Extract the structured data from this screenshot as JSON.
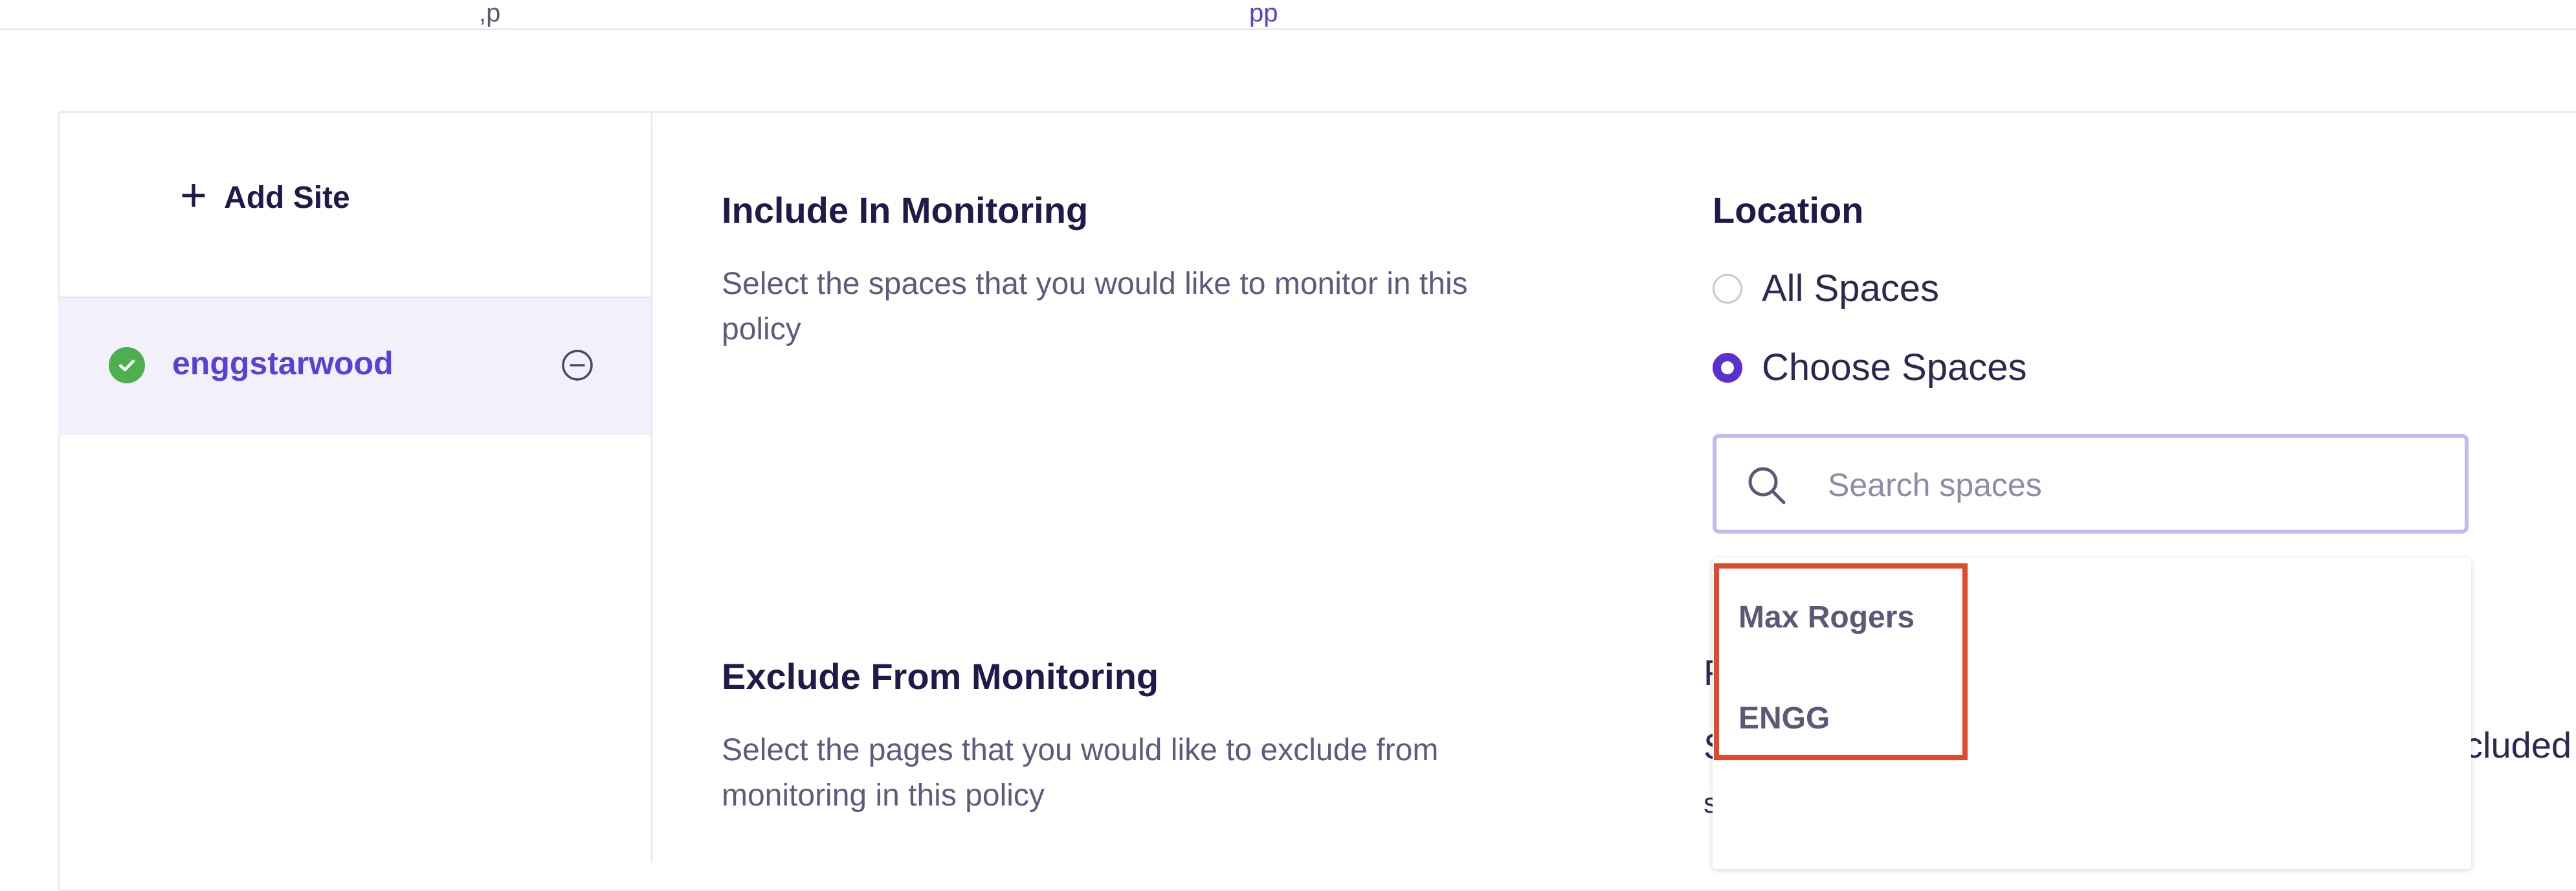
{
  "top_fragments": [
    ",p",
    "pp"
  ],
  "sidebar": {
    "add_site_label": "Add Site",
    "sites": [
      {
        "name": "enggstarwood",
        "status": "ok"
      }
    ]
  },
  "include": {
    "title": "Include In Monitoring",
    "description_line1": "Select the spaces that you would like to monitor in this",
    "description_line2": "policy"
  },
  "exclude": {
    "title": "Exclude From Monitoring",
    "description_line1": "Select the pages that you would like to exclude from",
    "description_line2": "monitoring in this policy"
  },
  "location": {
    "title": "Location",
    "options": [
      "All Spaces",
      "Choose Spaces"
    ],
    "selected": "Choose Spaces"
  },
  "search": {
    "placeholder": "Search spaces",
    "value": ""
  },
  "dropdown": {
    "options": [
      "Max Rogers",
      "ENGG"
    ]
  },
  "behind_dropdown": {
    "right_text": "cluded"
  },
  "colors": {
    "accent": "#5b2fd0",
    "highlight_border": "#e04a2c",
    "success": "#4caf50",
    "selected_row_bg": "#f2f0fb"
  }
}
